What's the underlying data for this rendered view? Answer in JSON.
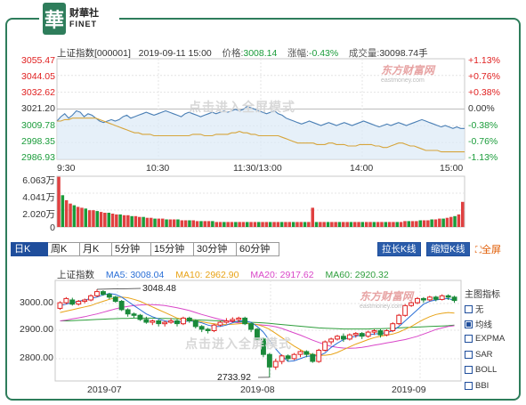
{
  "brand": {
    "mark": "華",
    "name_cn": "财華社",
    "name_en": "FINET"
  },
  "intraday": {
    "index_name": "上证指数[000001]",
    "datetime": "2019-09-11 15:00",
    "price_label": "价格:",
    "price": "3008.14",
    "change_label": "涨幅:",
    "change": "-0.43%",
    "volume_label": "成交量:",
    "volume": "30098.74手",
    "price_axis": [
      "3055.47",
      "3044.05",
      "3032.62",
      "3021.20",
      "3009.78",
      "2998.35",
      "2986.93"
    ],
    "pct_axis": [
      "+1.13%",
      "+0.76%",
      "+0.38%",
      "0.00%",
      "-0.38%",
      "-0.76%",
      "-1.13%"
    ],
    "time_axis": [
      "9:30",
      "10:30",
      "11:30/13:00",
      "14:00",
      "15:00"
    ],
    "volume_axis": [
      "6.063万",
      "4.041万",
      "2.020万",
      "0"
    ],
    "watermark": "点击进入全屏模式",
    "logo_watermark": "东方财富网",
    "logo_watermark_sub": "eastmoney.com",
    "price_line": [
      3013,
      3016,
      3018,
      3015,
      3017,
      3020,
      3019,
      3016,
      3018,
      3017,
      3015,
      3013,
      3012,
      3013,
      3014,
      3013,
      3014,
      3016,
      3017,
      3015,
      3016,
      3017,
      3018,
      3019,
      3018,
      3017,
      3018,
      3019,
      3020,
      3019,
      3018,
      3017,
      3016,
      3018,
      3019,
      3018,
      3017,
      3016,
      3017,
      3018,
      3019,
      3018,
      3019,
      3020,
      3019,
      3020,
      3021,
      3020,
      3021,
      3023,
      3022,
      3021,
      3020,
      3019,
      3018,
      3019,
      3020,
      3018,
      3017,
      3015,
      3014,
      3013,
      3012,
      3011,
      3012,
      3013,
      3012,
      3011,
      3010,
      3011,
      3012,
      3011,
      3010,
      3011,
      3012,
      3011,
      3010,
      3011,
      3012,
      3013,
      3012,
      3011,
      3010,
      3009,
      3010,
      3011,
      3010,
      3011,
      3012,
      3011,
      3010,
      3011,
      3012,
      3013,
      3014,
      3013,
      3012,
      3011,
      3010,
      3009,
      3010,
      3009,
      3008,
      3009,
      3008,
      3008
    ],
    "avg_line": [
      3013,
      3013,
      3014,
      3014,
      3015,
      3015,
      3015,
      3015,
      3015,
      3015,
      3015,
      3014,
      3013,
      3012,
      3011,
      3010,
      3009,
      3008,
      3007,
      3006,
      3005,
      3005,
      3004,
      3004,
      3004,
      3003,
      3003,
      3003,
      3003,
      3003,
      3003,
      3003,
      3003,
      3003,
      3003,
      3004,
      3004,
      3004,
      3003,
      3003,
      3003,
      3004,
      3004,
      3004,
      3004,
      3005,
      3005,
      3006,
      3005,
      3005,
      3004,
      3004,
      3003,
      3003,
      3003,
      3003,
      3003,
      3003,
      3002,
      3001,
      3000,
      2999,
      2998,
      2998,
      2998,
      2998,
      2998,
      2997,
      2997,
      2997,
      2998,
      2998,
      2997,
      2997,
      2997,
      2996,
      2996,
      2996,
      2997,
      2997,
      2997,
      2997,
      2996,
      2996,
      2995,
      2995,
      2996,
      2997,
      2998,
      2998,
      2997,
      2996,
      2996,
      2995,
      2994,
      2993,
      2993,
      2993,
      2993,
      2992,
      2992,
      2992,
      2992,
      2992,
      2992,
      2992
    ],
    "volumes": [
      6.0,
      3.8,
      3.2,
      2.8,
      2.6,
      2.4,
      2.3,
      2.2,
      2.0,
      2.0,
      1.9,
      1.8,
      1.7,
      1.7,
      1.6,
      1.5,
      1.5,
      1.4,
      1.4,
      1.3,
      1.3,
      1.2,
      1.2,
      1.1,
      1.1,
      1.0,
      1.0,
      1.0,
      0.9,
      0.9,
      0.9,
      0.9,
      0.8,
      0.8,
      0.8,
      0.8,
      0.7,
      0.7,
      0.7,
      0.7,
      0.7,
      0.6,
      0.6,
      0.6,
      0.6,
      0.6,
      0.6,
      0.6,
      0.6,
      0.6,
      0.6,
      0.6,
      0.6,
      0.6,
      0.6,
      0.6,
      0.6,
      0.6,
      0.6,
      0.6,
      0.6,
      0.6,
      0.6,
      0.6,
      0.6,
      0.6,
      2.3,
      0.6,
      0.6,
      0.6,
      0.6,
      0.6,
      0.6,
      0.6,
      0.6,
      0.6,
      0.6,
      0.6,
      0.6,
      0.6,
      0.6,
      0.6,
      0.6,
      0.6,
      0.6,
      0.6,
      0.6,
      0.6,
      0.6,
      0.6,
      0.7,
      0.7,
      0.7,
      0.7,
      0.8,
      0.8,
      0.8,
      0.9,
      0.9,
      1.0,
      1.0,
      1.1,
      1.2,
      1.3,
      1.5,
      3.0
    ]
  },
  "tabs": [
    {
      "label": "日K",
      "active": true
    },
    {
      "label": "周K",
      "active": false
    },
    {
      "label": "月K",
      "active": false
    },
    {
      "label": "5分钟",
      "active": false
    },
    {
      "label": "15分钟",
      "active": false
    },
    {
      "label": "30分钟",
      "active": false
    },
    {
      "label": "60分钟",
      "active": false
    }
  ],
  "tools": {
    "stretch": "拉长K线",
    "shrink": "缩短K线",
    "fullscreen": "全屏"
  },
  "kline": {
    "index_label": "上证指数",
    "ma5": "MA5: 3008.04",
    "ma10": "MA10: 2962.90",
    "ma20": "MA20: 2917.62",
    "ma60": "MA60: 2920.32",
    "ma_colors": {
      "ma5": "#2a6fd6",
      "ma10": "#e8a317",
      "ma20": "#d946c8",
      "ma60": "#2e9e3c"
    },
    "price_axis": [
      "3000.00",
      "2900.00",
      "2800.00"
    ],
    "date_axis": [
      "2019-07",
      "2019-08",
      "2019-09"
    ],
    "high_annotation": "3048.48",
    "low_annotation": "2733.92",
    "watermark": "点击进入全屏模式",
    "logo_watermark": "东方财富网",
    "logo_watermark_sub": "eastmoney.com",
    "candles": [
      [
        2980,
        3000,
        2975,
        3005
      ],
      [
        3000,
        3015,
        2995,
        3020
      ],
      [
        3010,
        2995,
        2990,
        3018
      ],
      [
        2995,
        3005,
        2990,
        3010
      ],
      [
        3005,
        3010,
        2998,
        3015
      ],
      [
        3010,
        3025,
        3005,
        3030
      ],
      [
        3025,
        3040,
        3020,
        3048
      ],
      [
        3040,
        3030,
        3025,
        3045
      ],
      [
        3030,
        3020,
        3012,
        3035
      ],
      [
        3020,
        3005,
        3000,
        3025
      ],
      [
        3005,
        2975,
        2970,
        3010
      ],
      [
        2975,
        2960,
        2950,
        2980
      ],
      [
        2960,
        2955,
        2945,
        2965
      ],
      [
        2955,
        2940,
        2935,
        2960
      ],
      [
        2940,
        2930,
        2925,
        2950
      ],
      [
        2930,
        2935,
        2920,
        2940
      ],
      [
        2935,
        2925,
        2915,
        2940
      ],
      [
        2925,
        2930,
        2915,
        2935
      ],
      [
        2930,
        2935,
        2925,
        2945
      ],
      [
        2935,
        2925,
        2915,
        2940
      ],
      [
        2925,
        2945,
        2920,
        2950
      ],
      [
        2945,
        2935,
        2928,
        2950
      ],
      [
        2935,
        2915,
        2908,
        2940
      ],
      [
        2915,
        2905,
        2895,
        2920
      ],
      [
        2905,
        2900,
        2890,
        2910
      ],
      [
        2900,
        2920,
        2895,
        2925
      ],
      [
        2920,
        2930,
        2915,
        2935
      ],
      [
        2930,
        2935,
        2925,
        2945
      ],
      [
        2935,
        2940,
        2930,
        2948
      ],
      [
        2940,
        2945,
        2930,
        2950
      ],
      [
        2945,
        2925,
        2920,
        2950
      ],
      [
        2925,
        2905,
        2895,
        2930
      ],
      [
        2905,
        2870,
        2860,
        2910
      ],
      [
        2870,
        2815,
        2805,
        2875
      ],
      [
        2815,
        2770,
        2733,
        2820
      ],
      [
        2770,
        2790,
        2760,
        2800
      ],
      [
        2790,
        2810,
        2780,
        2815
      ],
      [
        2810,
        2800,
        2790,
        2815
      ],
      [
        2800,
        2815,
        2795,
        2820
      ],
      [
        2815,
        2825,
        2805,
        2830
      ],
      [
        2825,
        2815,
        2805,
        2830
      ],
      [
        2815,
        2790,
        2785,
        2820
      ],
      [
        2790,
        2830,
        2785,
        2835
      ],
      [
        2830,
        2860,
        2825,
        2865
      ],
      [
        2860,
        2870,
        2850,
        2875
      ],
      [
        2870,
        2880,
        2865,
        2885
      ],
      [
        2880,
        2870,
        2860,
        2890
      ],
      [
        2870,
        2885,
        2865,
        2890
      ],
      [
        2885,
        2890,
        2875,
        2895
      ],
      [
        2890,
        2880,
        2870,
        2895
      ],
      [
        2880,
        2895,
        2875,
        2900
      ],
      [
        2895,
        2900,
        2885,
        2905
      ],
      [
        2900,
        2885,
        2875,
        2905
      ],
      [
        2885,
        2900,
        2880,
        2905
      ],
      [
        2900,
        2925,
        2895,
        2930
      ],
      [
        2925,
        2955,
        2920,
        2960
      ],
      [
        2955,
        2990,
        2950,
        2995
      ],
      [
        2990,
        3000,
        2985,
        3005
      ],
      [
        3000,
        3015,
        2995,
        3020
      ],
      [
        3015,
        3010,
        3000,
        3020
      ],
      [
        3010,
        3020,
        3005,
        3025
      ],
      [
        3020,
        3012,
        3005,
        3025
      ],
      [
        3012,
        3025,
        3008,
        3030
      ],
      [
        3025,
        3020,
        3010,
        3030
      ],
      [
        3020,
        3008,
        3000,
        3025
      ]
    ],
    "ma5_line": [
      2990,
      2995,
      3000,
      3005,
      3010,
      3015,
      3020,
      3028,
      3033,
      3030,
      3020,
      3005,
      2990,
      2975,
      2960,
      2950,
      2942,
      2935,
      2932,
      2930,
      2932,
      2935,
      2933,
      2928,
      2920,
      2915,
      2915,
      2920,
      2928,
      2935,
      2935,
      2930,
      2915,
      2895,
      2865,
      2835,
      2810,
      2790,
      2792,
      2800,
      2808,
      2810,
      2810,
      2820,
      2840,
      2855,
      2868,
      2875,
      2880,
      2885,
      2885,
      2888,
      2890,
      2893,
      2900,
      2915,
      2935,
      2955,
      2975,
      2995,
      3005,
      3010,
      3013,
      3015,
      3008
    ],
    "ma10_line": [
      2965,
      2970,
      2975,
      2980,
      2985,
      2990,
      2998,
      3005,
      3012,
      3018,
      3020,
      3018,
      3012,
      3005,
      2995,
      2985,
      2975,
      2965,
      2955,
      2945,
      2940,
      2938,
      2935,
      2932,
      2928,
      2925,
      2922,
      2922,
      2923,
      2925,
      2926,
      2925,
      2922,
      2915,
      2905,
      2890,
      2875,
      2860,
      2845,
      2832,
      2820,
      2815,
      2812,
      2812,
      2815,
      2822,
      2832,
      2842,
      2852,
      2860,
      2868,
      2875,
      2880,
      2884,
      2888,
      2895,
      2905,
      2915,
      2928,
      2940,
      2950,
      2958,
      2962,
      2965,
      2963
    ],
    "ma20_line": [
      2935,
      2938,
      2942,
      2946,
      2950,
      2955,
      2960,
      2966,
      2972,
      2978,
      2983,
      2987,
      2990,
      2992,
      2993,
      2993,
      2992,
      2990,
      2986,
      2982,
      2977,
      2972,
      2965,
      2958,
      2952,
      2946,
      2940,
      2935,
      2931,
      2928,
      2926,
      2924,
      2922,
      2920,
      2918,
      2914,
      2908,
      2900,
      2892,
      2884,
      2875,
      2866,
      2858,
      2850,
      2844,
      2840,
      2838,
      2837,
      2838,
      2840,
      2844,
      2848,
      2852,
      2856,
      2860,
      2864,
      2868,
      2874,
      2880,
      2888,
      2896,
      2904,
      2910,
      2915,
      2918
    ],
    "ma60_line": [
      2935,
      2935,
      2936,
      2937,
      2938,
      2939,
      2940,
      2941,
      2942,
      2943,
      2944,
      2944,
      2945,
      2945,
      2945,
      2945,
      2944,
      2944,
      2943,
      2942,
      2941,
      2940,
      2939,
      2938,
      2937,
      2936,
      2935,
      2934,
      2933,
      2932,
      2931,
      2930,
      2929,
      2928,
      2926,
      2924,
      2922,
      2920,
      2918,
      2916,
      2914,
      2912,
      2910,
      2909,
      2908,
      2907,
      2906,
      2906,
      2906,
      2906,
      2906,
      2907,
      2907,
      2908,
      2909,
      2910,
      2911,
      2912,
      2913,
      2914,
      2915,
      2916,
      2917,
      2918,
      2920
    ]
  },
  "indicators": {
    "title": "主图指标",
    "items": [
      {
        "label": "无",
        "checked": false
      },
      {
        "label": "均线",
        "checked": true
      },
      {
        "label": "EXPMA",
        "checked": false
      },
      {
        "label": "SAR",
        "checked": false
      },
      {
        "label": "BOLL",
        "checked": false
      },
      {
        "label": "BBI",
        "checked": false
      }
    ]
  }
}
